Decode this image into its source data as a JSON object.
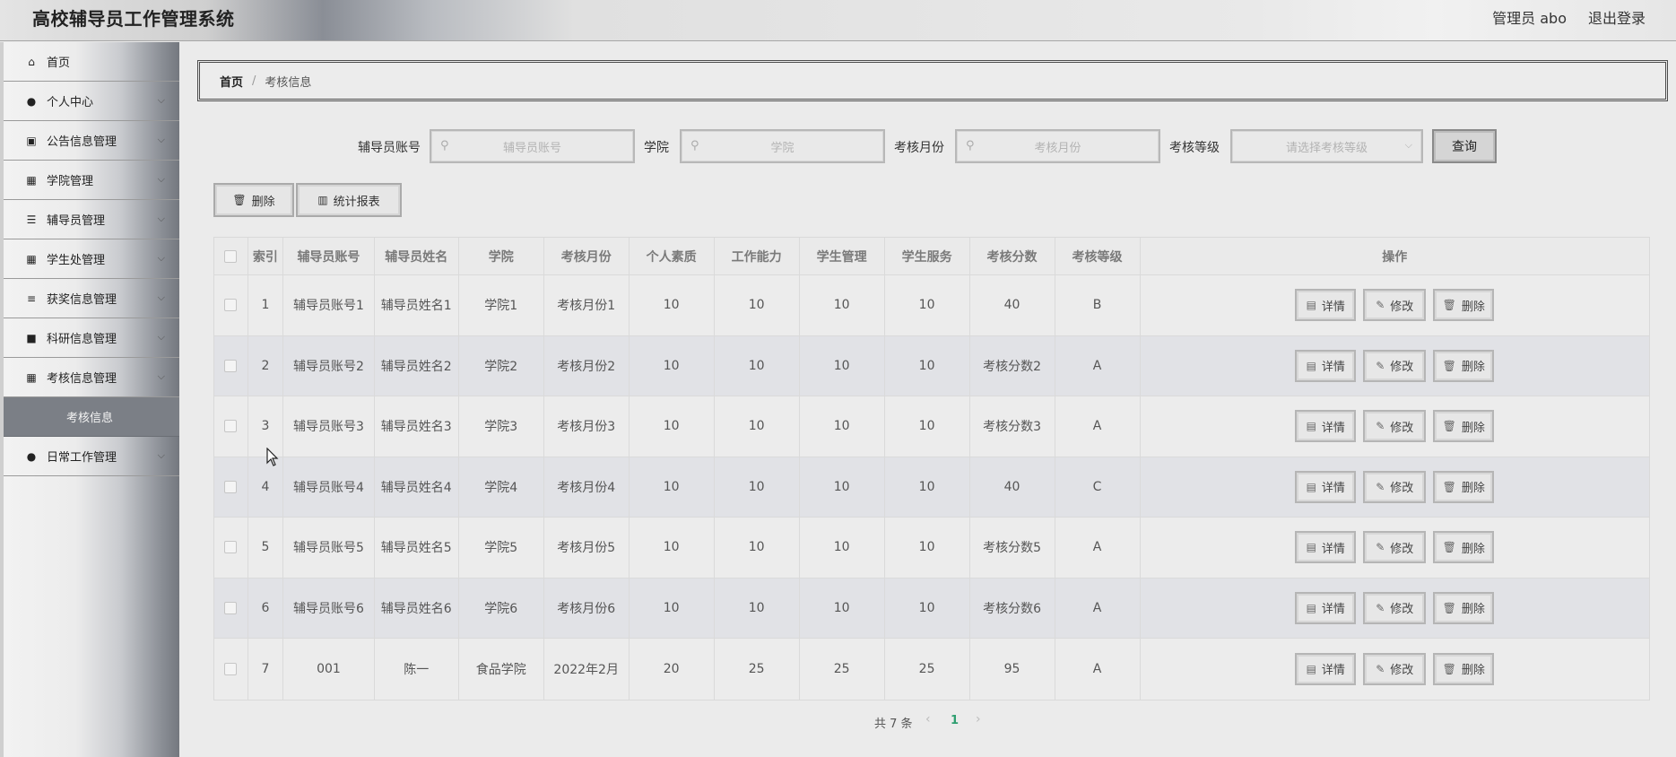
{
  "header": {
    "title": "高校辅导员工作管理系统",
    "user": "管理员 abo",
    "logout": "退出登录"
  },
  "sidebar": {
    "items": [
      {
        "label": "首页",
        "icon": "home-icon",
        "glyph": "⌂",
        "expandable": false
      },
      {
        "label": "个人中心",
        "icon": "user-icon",
        "glyph": "●",
        "expandable": true
      },
      {
        "label": "公告信息管理",
        "icon": "chart-icon",
        "glyph": "▣",
        "expandable": true
      },
      {
        "label": "学院管理",
        "icon": "grid-icon",
        "glyph": "▦",
        "expandable": true
      },
      {
        "label": "辅导员管理",
        "icon": "list-icon",
        "glyph": "☰",
        "expandable": true
      },
      {
        "label": "学生处管理",
        "icon": "grid-icon",
        "glyph": "▦",
        "expandable": true
      },
      {
        "label": "获奖信息管理",
        "icon": "sliders-icon",
        "glyph": "≡",
        "expandable": true
      },
      {
        "label": "科研信息管理",
        "icon": "briefcase-icon",
        "glyph": "■",
        "expandable": true
      },
      {
        "label": "考核信息管理",
        "icon": "grid-icon",
        "glyph": "▦",
        "expandable": true
      }
    ],
    "sub_active": "考核信息",
    "last_item": {
      "label": "日常工作管理",
      "icon": "pin-icon",
      "glyph": "●",
      "expandable": true
    }
  },
  "breadcrumb": {
    "home": "首页",
    "separator": "/",
    "current": "考核信息"
  },
  "search": {
    "fields": [
      {
        "label": "辅导员账号",
        "placeholder": "辅导员账号"
      },
      {
        "label": "学院",
        "placeholder": "学院"
      },
      {
        "label": "考核月份",
        "placeholder": "考核月份"
      },
      {
        "label": "考核等级",
        "placeholder": "请选择考核等级"
      }
    ],
    "query_label": "查询"
  },
  "actions": {
    "delete_label": "删除",
    "report_label": "统计报表"
  },
  "table": {
    "columns": [
      "索引",
      "辅导员账号",
      "辅导员姓名",
      "学院",
      "考核月份",
      "个人素质",
      "工作能力",
      "学生管理",
      "学生服务",
      "考核分数",
      "考核等级",
      "操作"
    ],
    "rows": [
      [
        "1",
        "辅导员账号1",
        "辅导员姓名1",
        "学院1",
        "考核月份1",
        "10",
        "10",
        "10",
        "10",
        "40",
        "B"
      ],
      [
        "2",
        "辅导员账号2",
        "辅导员姓名2",
        "学院2",
        "考核月份2",
        "10",
        "10",
        "10",
        "10",
        "考核分数2",
        "A"
      ],
      [
        "3",
        "辅导员账号3",
        "辅导员姓名3",
        "学院3",
        "考核月份3",
        "10",
        "10",
        "10",
        "10",
        "考核分数3",
        "A"
      ],
      [
        "4",
        "辅导员账号4",
        "辅导员姓名4",
        "学院4",
        "考核月份4",
        "10",
        "10",
        "10",
        "10",
        "40",
        "C"
      ],
      [
        "5",
        "辅导员账号5",
        "辅导员姓名5",
        "学院5",
        "考核月份5",
        "10",
        "10",
        "10",
        "10",
        "考核分数5",
        "A"
      ],
      [
        "6",
        "辅导员账号6",
        "辅导员姓名6",
        "学院6",
        "考核月份6",
        "10",
        "10",
        "10",
        "10",
        "考核分数6",
        "A"
      ],
      [
        "7",
        "001",
        "陈一",
        "食品学院",
        "2022年2月",
        "20",
        "25",
        "25",
        "25",
        "95",
        "A"
      ]
    ],
    "row_actions": [
      "详情",
      "修改",
      "删除"
    ]
  },
  "pagination": {
    "total": "共 7 条",
    "current": "1",
    "prev": "‹",
    "next": "›"
  }
}
